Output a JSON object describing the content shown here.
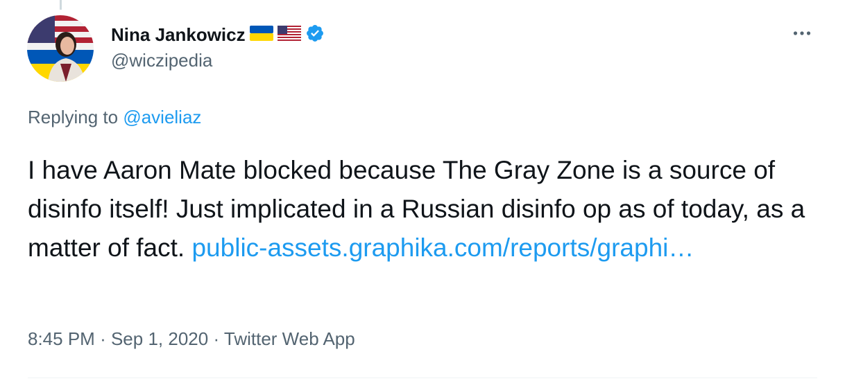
{
  "author": {
    "display_name": "Nina Jankowicz",
    "handle": "@wiczipedia",
    "flags": [
      "ukraine-flag",
      "us-flag"
    ],
    "verified": true
  },
  "reply": {
    "prefix": "Replying to",
    "mention": "@avieliaz"
  },
  "tweet": {
    "text": "I have Aaron Mate blocked because The Gray Zone is a source of disinfo itself! Just implicated in a Russian disinfo op as of today, as a matter of fact. ",
    "link": "public-assets.graphika.com/reports/graphi…"
  },
  "meta": {
    "time": "8:45 PM",
    "separator": "·",
    "date": "Sep 1, 2020",
    "source": "Twitter Web App"
  },
  "colors": {
    "text": "#0f1419",
    "secondary": "#536471",
    "link": "#1d9bf0",
    "verified": "#1d9bf0",
    "divider": "#eff3f4"
  },
  "icons": {
    "more": "more-horizontal-icon",
    "verified": "verified-badge-icon"
  }
}
